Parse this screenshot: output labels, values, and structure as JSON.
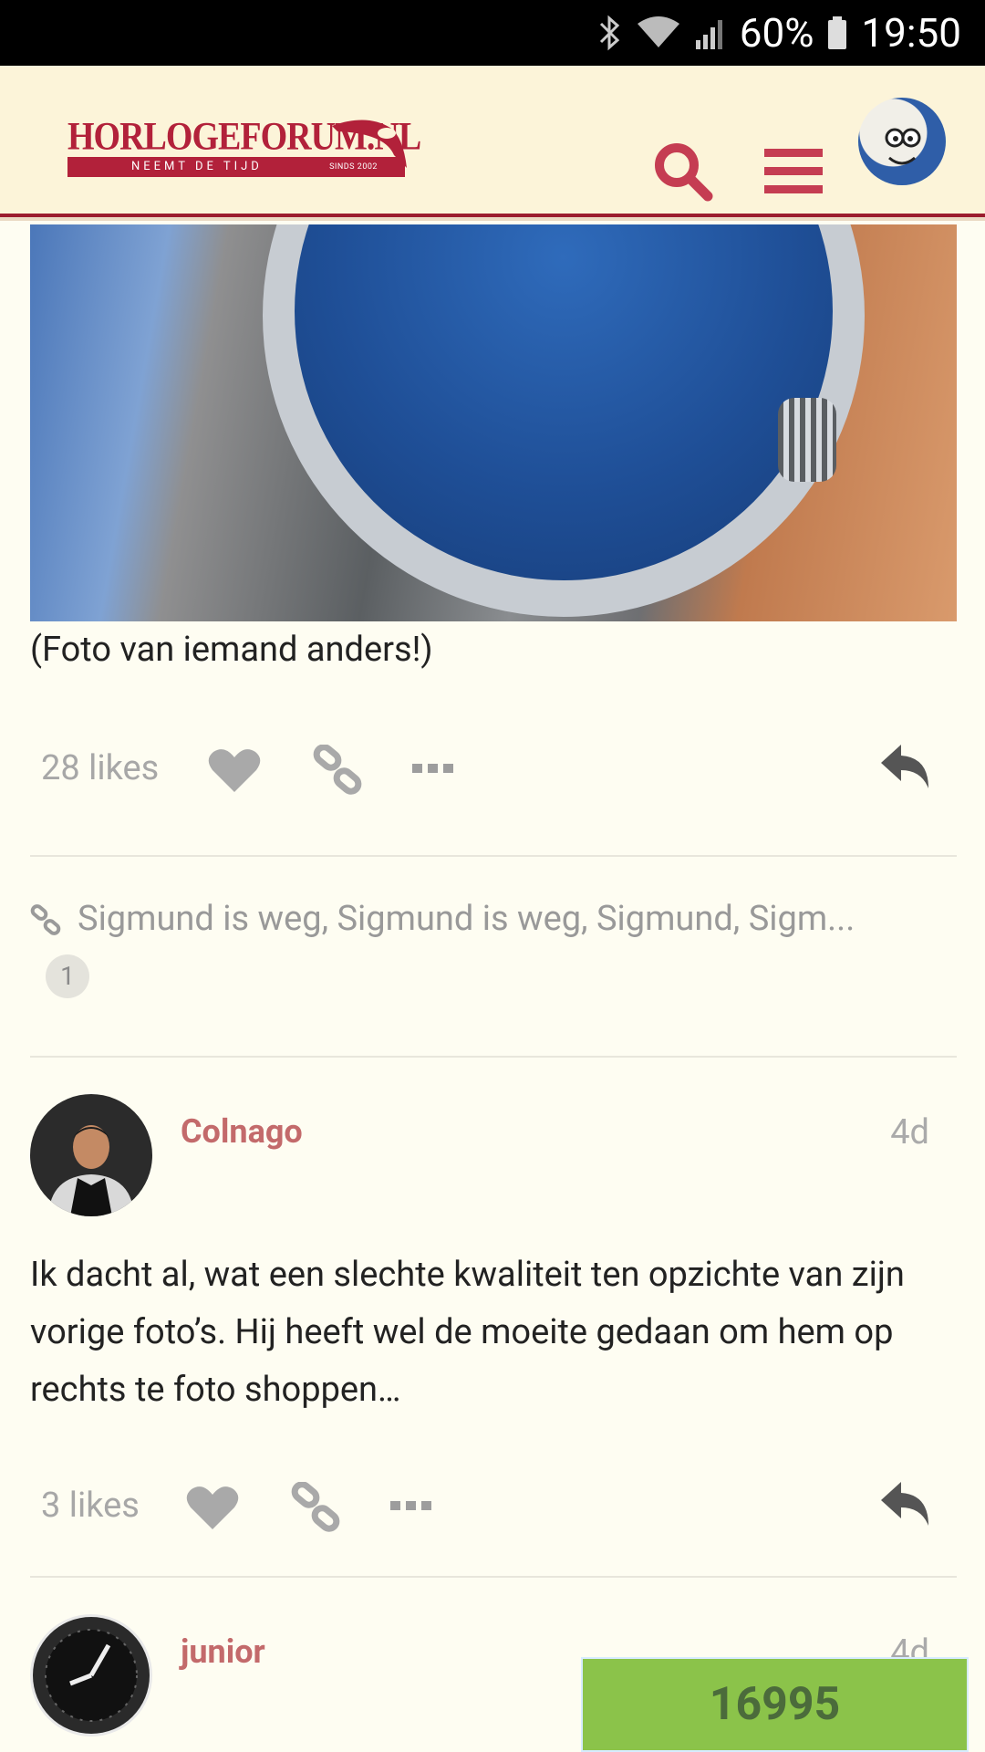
{
  "status_bar": {
    "battery": "60%",
    "time": "19:50"
  },
  "header": {
    "logo_text": "HORLOGEFORUM.NL",
    "logo_tagline": "NEEMT DE TIJD",
    "logo_since": "SINDS 2002",
    "icons": [
      "search-icon",
      "hamburger-menu-icon",
      "user-avatar"
    ],
    "accent_color": "#b2213a"
  },
  "post1": {
    "caption": "(Foto van iemand anders!)",
    "likes": "28 likes",
    "linked_topics": "Sigmund is weg, Sigmund is weg, Sigmund, Sigm...",
    "link_count": "1"
  },
  "post2": {
    "username": "Colnago",
    "date": "4d",
    "body": "Ik dacht al, wat een slechte kwaliteit ten opzichte van zijn vorige foto’s. Hij heeft wel de moeite gedaan om hem op rechts te foto shoppen…",
    "likes": "3 likes"
  },
  "post3": {
    "username": "junior",
    "date": "4d"
  },
  "overlay_counter": "16995"
}
